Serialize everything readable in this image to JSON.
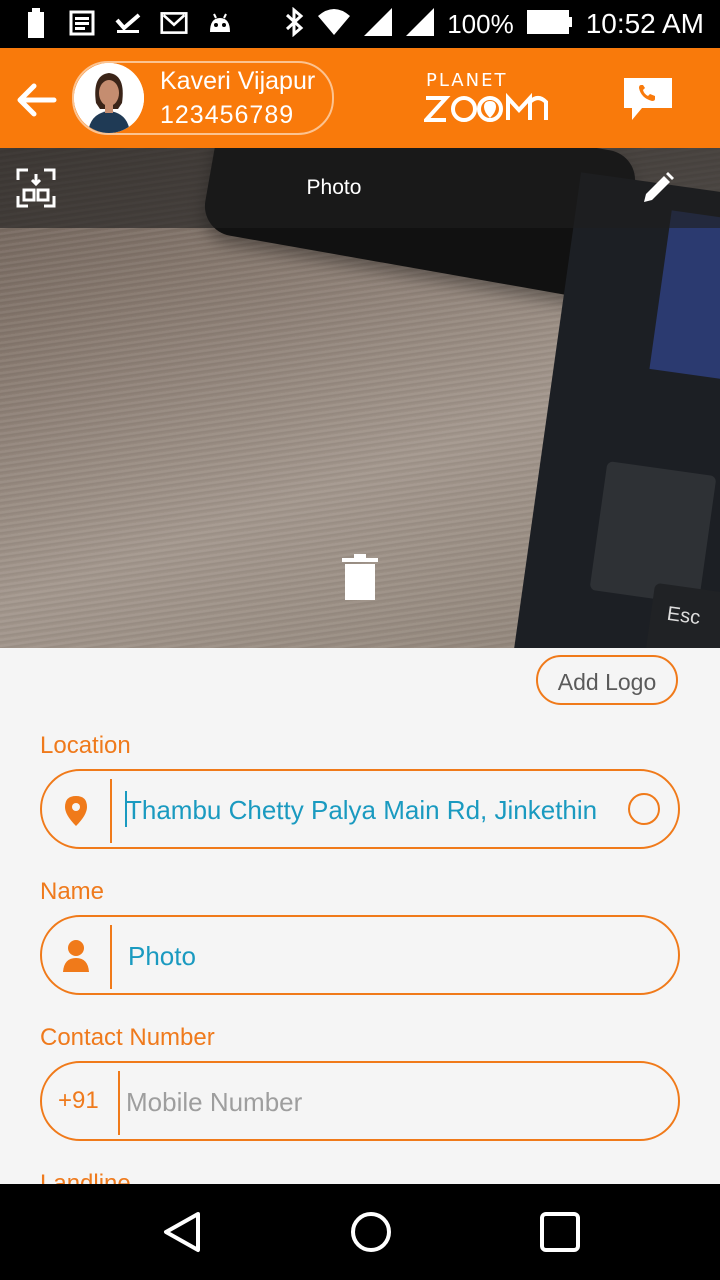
{
  "status_bar": {
    "battery_pct": "100%",
    "time": "10:52 AM",
    "left_icons": [
      "battery-icon",
      "news-icon",
      "check-icon",
      "gmail-icon",
      "android-icon"
    ],
    "right_icons": [
      "bluetooth-icon",
      "wifi-icon",
      "signal-icon",
      "signal-icon",
      "battery-icon"
    ]
  },
  "header": {
    "profile_name": "Kaveri Vijapur",
    "profile_phone": "123456789",
    "logo_top": "PLANET",
    "logo_bottom": "ZOOM",
    "accent_color": "#f97a0b"
  },
  "photo_panel": {
    "title": "Photo"
  },
  "form": {
    "add_logo_label": "Add Logo",
    "location_label": "Location",
    "location_value": "Thambu Chetty Palya Main Rd, Jinkethin",
    "name_label": "Name",
    "name_value": "Photo",
    "contact_label": "Contact Number",
    "contact_prefix": "+91",
    "contact_placeholder": "Mobile Number",
    "landline_label": "Landline"
  },
  "colors": {
    "accent": "#f07a1a",
    "input_text": "#1a9ac0",
    "placeholder": "#9e9e9e"
  }
}
